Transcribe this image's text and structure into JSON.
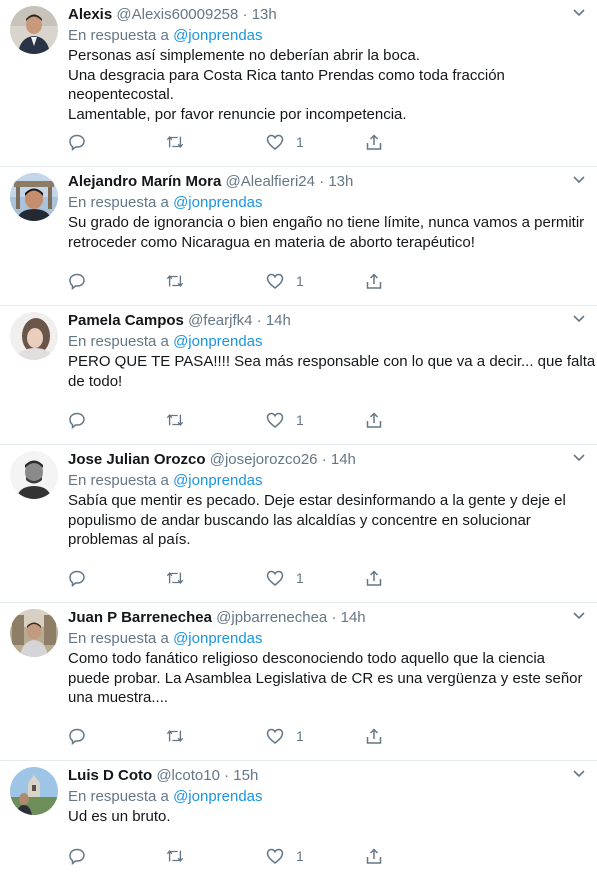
{
  "reply_prefix": "En respuesta a",
  "tweets": [
    {
      "name": "Alexis",
      "handle": "@Alexis60009258",
      "time": "13h",
      "mention": "@jonprendas",
      "lines": [
        "Personas así simplemente no deberían abrir la boca.",
        "Una desgracia para Costa Rica tanto Prendas como toda fracción",
        "neopentecostal.",
        "Lamentable, por favor renuncie por incompetencia."
      ],
      "likes": "1"
    },
    {
      "name": "Alejandro Marín Mora",
      "handle": "@Alealfieri24",
      "time": "13h",
      "mention": "@jonprendas",
      "lines": [
        "Su grado de ignorancia o bien engaño no tiene límite, nunca vamos a permitir",
        "retroceder como Nicaragua en materia de aborto terapéutico!"
      ],
      "likes": "1"
    },
    {
      "name": "Pamela Campos",
      "handle": "@fearjfk4",
      "time": "14h",
      "mention": "@jonprendas",
      "lines": [
        "PERO QUE TE PASA!!!! Sea más responsable con lo que va a decir... que falta",
        "de todo!"
      ],
      "likes": "1"
    },
    {
      "name": "Jose Julian Orozco",
      "handle": "@josejorozco26",
      "time": "14h",
      "mention": "@jonprendas",
      "lines": [
        "Sabía que mentir es pecado. Deje estar desinformando a la gente  y deje el",
        "populismo de andar buscando las alcaldías y concentre en solucionar",
        "problemas al país."
      ],
      "likes": "1"
    },
    {
      "name": "Juan P Barrenechea",
      "handle": "@jpbarrenechea",
      "time": "14h",
      "mention": "@jonprendas",
      "lines": [
        "Como todo fanático religioso desconociendo todo aquello que la ciencia",
        "puede probar. La Asamblea Legislativa de CR es una vergüenza y este señor",
        "una muestra...."
      ],
      "likes": "1"
    },
    {
      "name": "Luis D Coto",
      "handle": "@lcoto10",
      "time": "15h",
      "mention": "@jonprendas",
      "lines": [
        "Ud es un bruto."
      ],
      "likes": "1"
    }
  ]
}
